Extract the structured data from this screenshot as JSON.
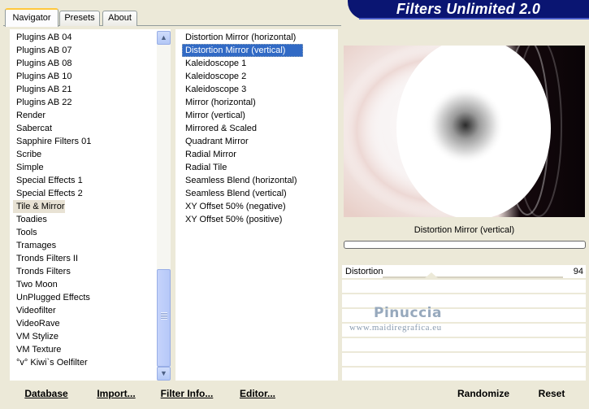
{
  "tabs": [
    {
      "label": "Navigator",
      "active": true
    },
    {
      "label": "Presets",
      "active": false
    },
    {
      "label": "About",
      "active": false
    }
  ],
  "header": {
    "title": "Filters Unlimited 2.0"
  },
  "categories": [
    "Plugins AB 04",
    "Plugins AB 07",
    "Plugins AB 08",
    "Plugins AB 10",
    "Plugins AB 21",
    "Plugins AB 22",
    "Render",
    "Sabercat",
    "Sapphire Filters 01",
    "Scribe",
    "Simple",
    "Special Effects 1",
    "Special Effects 2",
    "Tile & Mirror",
    "Toadies",
    "Tools",
    "Tramages",
    "Tronds Filters II",
    "Tronds Filters",
    "Two Moon",
    "UnPlugged Effects",
    "Videofilter",
    "VideoRave",
    "VM Stylize",
    "VM Texture",
    "°v° Kiwi`s Oelfilter"
  ],
  "selected_category": "Tile & Mirror",
  "filters": [
    "Distortion Mirror (horizontal)",
    "Distortion Mirror (vertical)",
    "Kaleidoscope 1",
    "Kaleidoscope 2",
    "Kaleidoscope 3",
    "Mirror (horizontal)",
    "Mirror (vertical)",
    "Mirrored & Scaled",
    "Quadrant Mirror",
    "Radial Mirror",
    "Radial Tile",
    "Seamless Blend (horizontal)",
    "Seamless Blend (vertical)",
    "XY Offset 50% (negative)",
    "XY Offset 50% (positive)"
  ],
  "selected_filter": "Distortion Mirror (vertical)",
  "preview": {
    "filter_name": "Distortion Mirror (vertical)"
  },
  "params": [
    {
      "label": "Distortion",
      "value": "94"
    }
  ],
  "watermark": {
    "name": "Pinuccia",
    "url": "www.maidiregrafica.eu"
  },
  "buttons": {
    "database": "Database",
    "import": "Import...",
    "filter_info": "Filter Info...",
    "editor": "Editor...",
    "randomize": "Randomize",
    "reset": "Reset"
  },
  "icons": {
    "scroll_up": "chevron-up-icon",
    "scroll_down": "chevron-down-icon"
  },
  "colors": {
    "window_bg": "#ece9d8",
    "banner_bg": "#0a1572",
    "selection": "#316ac5",
    "tab_accent": "#ffc83c"
  }
}
